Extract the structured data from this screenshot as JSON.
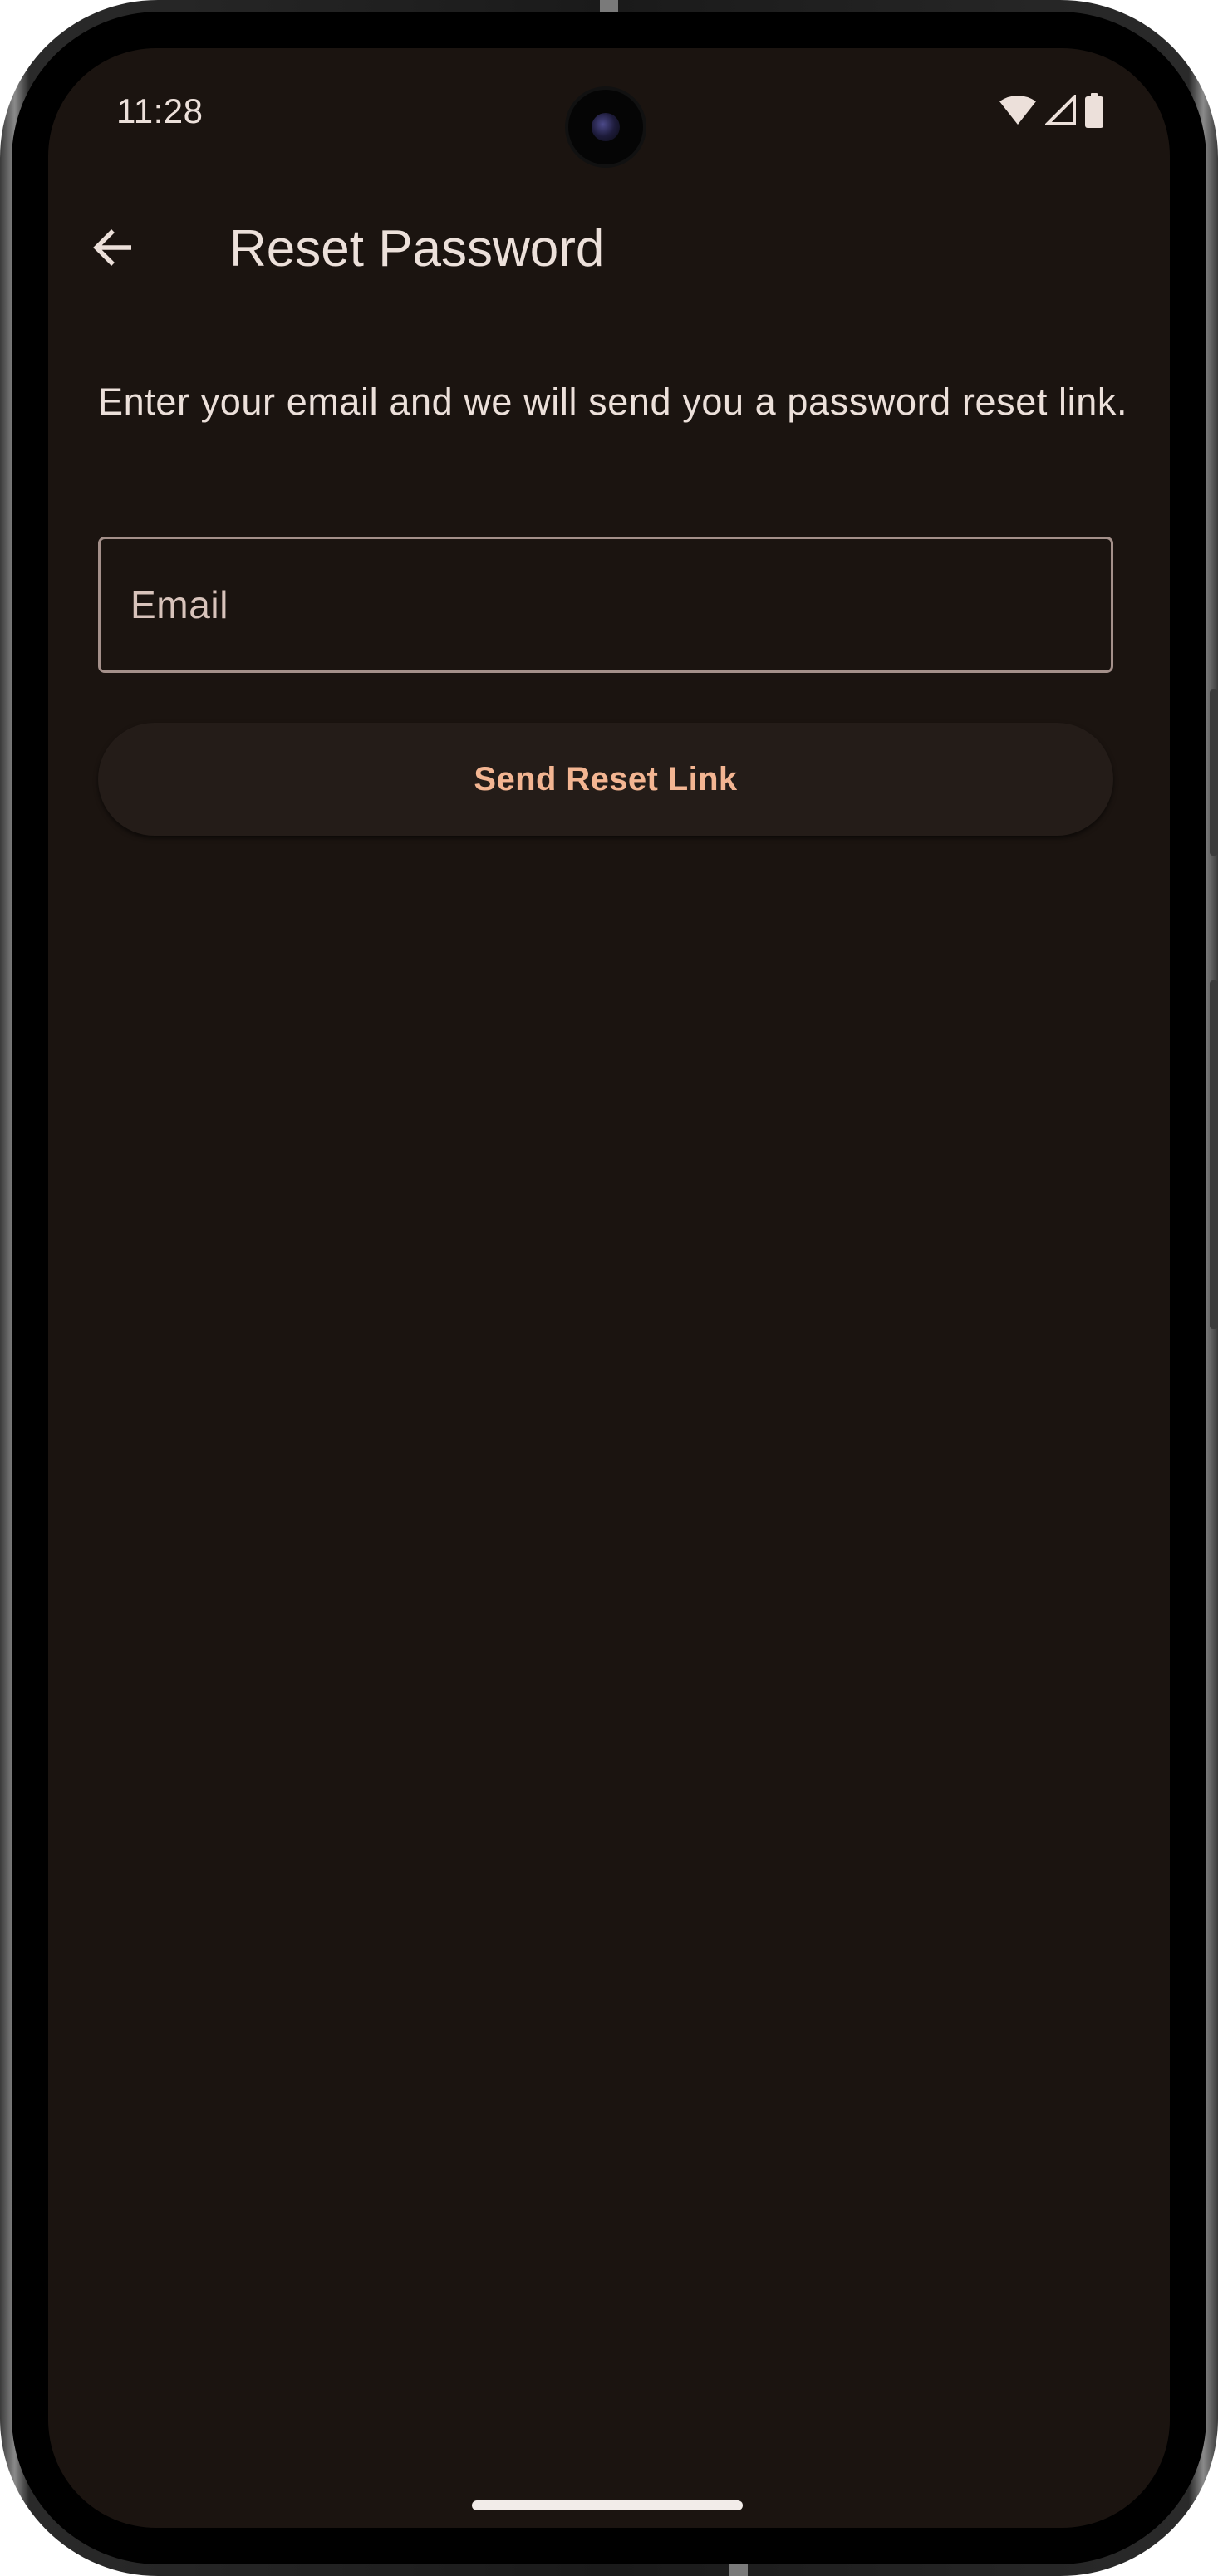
{
  "status_bar": {
    "time": "11:28",
    "icons": [
      "wifi-icon",
      "cell-signal-icon",
      "battery-icon"
    ]
  },
  "app_bar": {
    "back_icon": "arrow-left-icon",
    "title": "Reset Password"
  },
  "main": {
    "instructions": "Enter your email and we will send you a password reset link.",
    "email_field": {
      "label": "Email",
      "value": ""
    },
    "send_button": {
      "label": "Send Reset Link"
    }
  },
  "colors": {
    "background": "#1b1410",
    "text": "#ece0da",
    "accent": "#f3b592",
    "outline": "#a4908a",
    "button_surface": "#241c18"
  }
}
